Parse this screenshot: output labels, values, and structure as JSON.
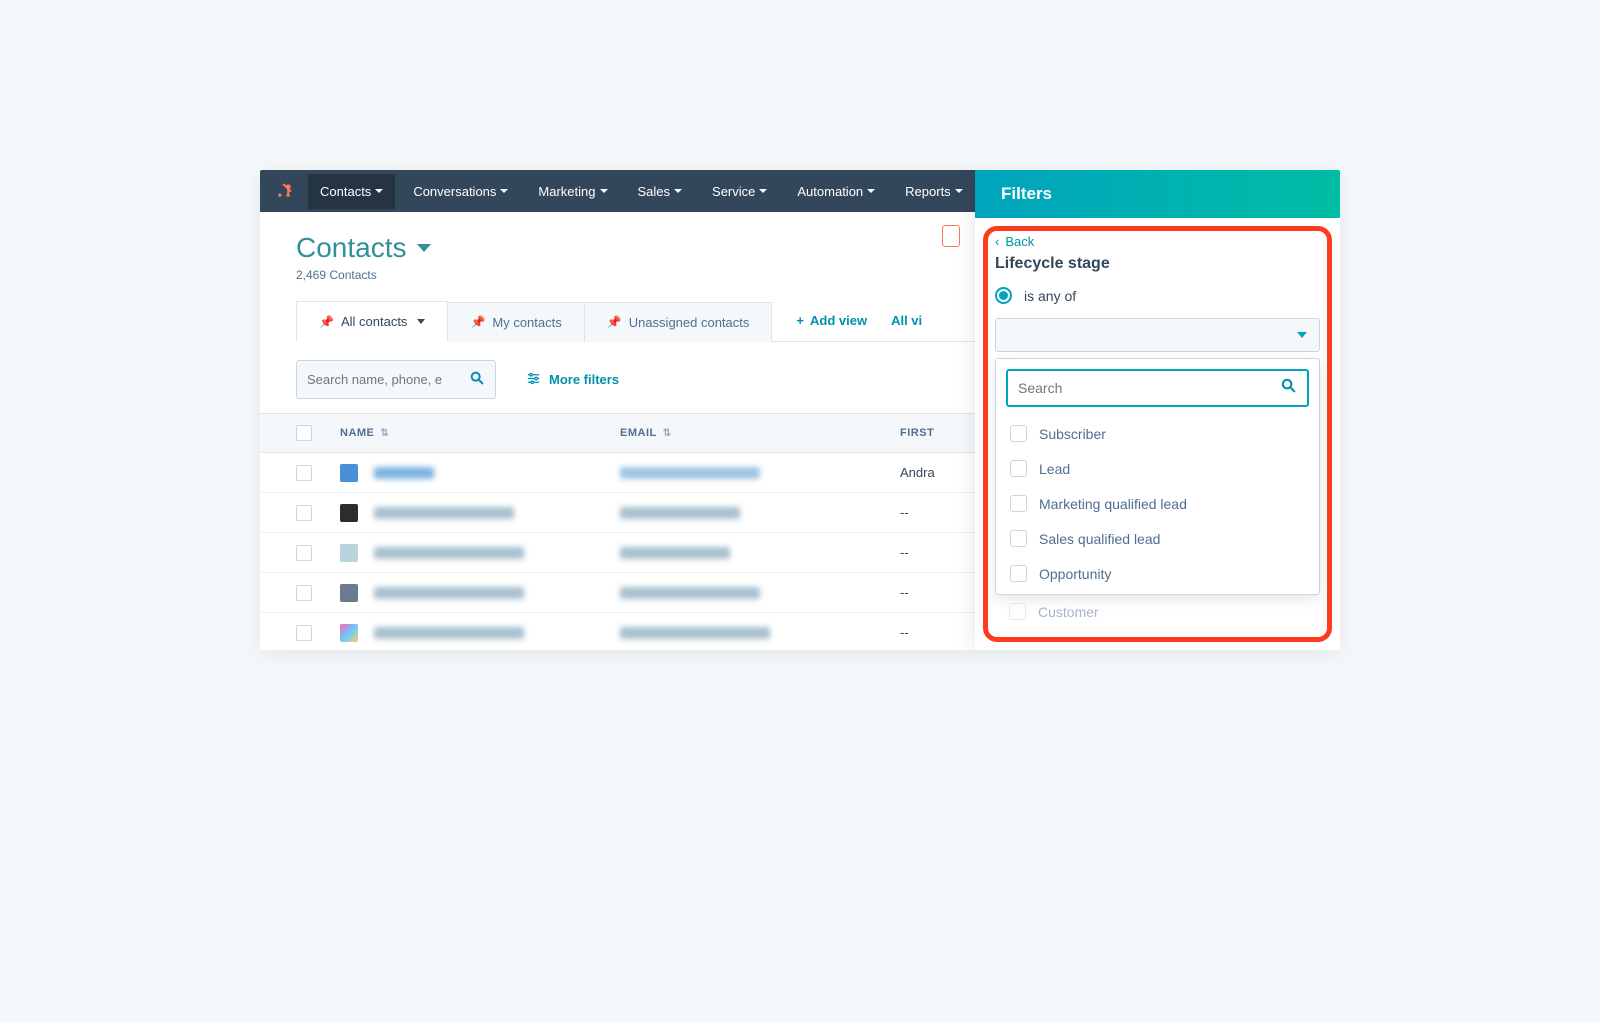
{
  "nav": {
    "items": [
      "Contacts",
      "Conversations",
      "Marketing",
      "Sales",
      "Service",
      "Automation",
      "Reports"
    ],
    "active_index": 0
  },
  "page": {
    "title": "Contacts",
    "count_text": "2,469 Contacts"
  },
  "tabs": {
    "items": [
      {
        "label": "All contacts",
        "pinned": true,
        "has_caret": true
      },
      {
        "label": "My contacts",
        "pinned": true,
        "has_caret": false
      },
      {
        "label": "Unassigned contacts",
        "pinned": true,
        "has_caret": false
      }
    ],
    "active_index": 0,
    "add_view_label": "Add view",
    "all_views_label": "All vi"
  },
  "toolbar": {
    "search_placeholder": "Search name, phone, e",
    "more_filters_label": "More filters"
  },
  "table": {
    "columns": [
      "NAME",
      "EMAIL",
      "FIRST"
    ],
    "rows": [
      {
        "avatar": "#4a90d9",
        "first": "Andra"
      },
      {
        "avatar": "#2c2c2c",
        "first": "--"
      },
      {
        "avatar": "#b8d4dd",
        "first": "--"
      },
      {
        "avatar": "#6b7a8f",
        "first": "--"
      },
      {
        "avatar": "linear-gradient(135deg,#f6a,#6cf,#fc6)",
        "first": "--"
      }
    ]
  },
  "panel": {
    "header": "Filters",
    "back_label": "Back",
    "filter_name": "Lifecycle stage",
    "condition_label": "is any of",
    "search_placeholder": "Search",
    "options": [
      "Subscriber",
      "Lead",
      "Marketing qualified lead",
      "Sales qualified lead",
      "Opportunity"
    ],
    "peek_option": "Customer"
  }
}
